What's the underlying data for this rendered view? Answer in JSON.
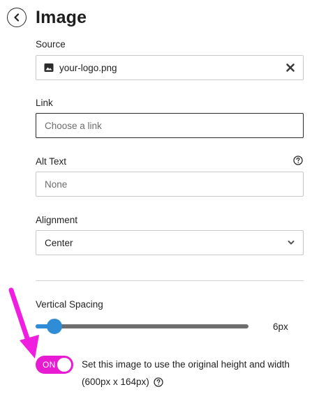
{
  "header": {
    "title": "Image"
  },
  "source": {
    "label": "Source",
    "value": "your-logo.png"
  },
  "link": {
    "label": "Link",
    "placeholder": "Choose a link"
  },
  "alt_text": {
    "label": "Alt Text",
    "placeholder": "None"
  },
  "alignment": {
    "label": "Alignment",
    "selected": "Center"
  },
  "vertical_spacing": {
    "label": "Vertical Spacing",
    "value_label": "6px",
    "level": 0.09
  },
  "original_size": {
    "toggle_label": "ON",
    "description_line1": "Set this image to use the original height and width",
    "description_line2": "(600px x 164px)"
  },
  "colors": {
    "accent": "#2f8cd6",
    "toggle_on": "#e81bd2",
    "annotation_arrow": "#f01fe0"
  },
  "icons": {
    "back": "chevron-left-circle-icon",
    "source": "image-icon",
    "clear": "close-icon",
    "help": "question-circle-icon",
    "dropdown": "chevron-down-icon"
  }
}
